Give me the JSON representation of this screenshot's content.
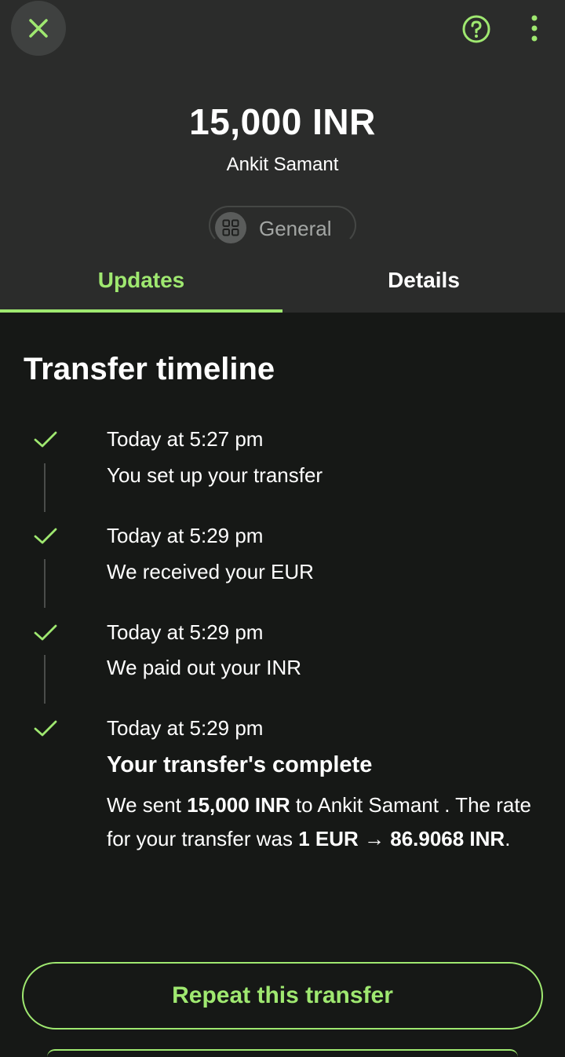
{
  "colors": {
    "accent": "#9fe870",
    "header_bg": "#2b2c2b",
    "body_bg": "#161816"
  },
  "header": {
    "amount": "15,000 INR",
    "recipient": "Ankit Samant",
    "category_label": "General",
    "close_icon": "close-icon",
    "help_icon": "help-circle-icon",
    "more_icon": "more-vertical-icon"
  },
  "tabs": [
    {
      "label": "Updates",
      "active": true
    },
    {
      "label": "Details",
      "active": false
    }
  ],
  "timeline": {
    "title": "Transfer timeline",
    "events": [
      {
        "time": "Today at 5:27 pm",
        "description": "You set up your transfer"
      },
      {
        "time": "Today at 5:29 pm",
        "description": "We received your EUR"
      },
      {
        "time": "Today at 5:29 pm",
        "description": "We paid out your INR"
      },
      {
        "time": "Today at 5:29 pm",
        "heading": "Your transfer's complete",
        "body": {
          "part1": "We sent ",
          "amount": "15,000 INR",
          "part2": " to Ankit Samant . The rate for your transfer was ",
          "rate": "1 EUR → 86.9068 INR",
          "part3": "."
        }
      }
    ]
  },
  "actions": {
    "repeat_label": "Repeat this transfer"
  }
}
